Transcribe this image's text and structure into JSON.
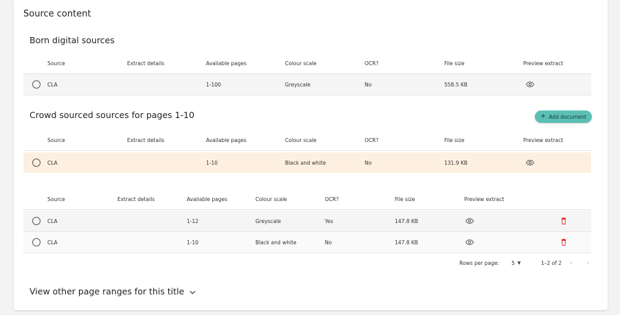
{
  "card_title": "Source content",
  "born_digital": {
    "title": "Born digital sources",
    "headers": [
      "Source",
      "Extract details",
      "Available pages",
      "Colour scale",
      "OCR?",
      "File size",
      "Preview extract"
    ],
    "rows": [
      {
        "source": "CLA",
        "extract": "",
        "pages": "1-100",
        "colour": "Greyscale",
        "ocr": "No",
        "size": "558.5 KB"
      }
    ]
  },
  "crowd": {
    "title": "Crowd sourced sources for pages 1-10",
    "add_label": "Add document",
    "headers": [
      "Source",
      "Extract details",
      "Available pages",
      "Colour scale",
      "OCR?",
      "File size",
      "Preview extract"
    ],
    "rows": [
      {
        "source": "CLA",
        "extract": "",
        "pages": "1-10",
        "colour": "Black and white",
        "ocr": "No",
        "size": "131.9 KB"
      }
    ]
  },
  "other": {
    "headers": [
      "Source",
      "Extract details",
      "Available pages",
      "Colour scale",
      "OCR?",
      "File size",
      "Preview extract"
    ],
    "rows": [
      {
        "source": "CLA",
        "extract": "",
        "pages": "1-12",
        "colour": "Greyscale",
        "ocr": "Yes",
        "size": "147.8 KB"
      },
      {
        "source": "CLA",
        "extract": "",
        "pages": "1-10",
        "colour": "Black and white",
        "ocr": "No",
        "size": "147.8 KB"
      }
    ],
    "pagination": {
      "rows_per_page_label": "Rows per page:",
      "rows_per_page": "5",
      "range": "1–2 of 2"
    }
  },
  "view_other_label": "View other page ranges for this title",
  "colors": {
    "accent": "#5bbfb5",
    "selected_row": "#fdf0e1",
    "delete": "#e53935"
  }
}
